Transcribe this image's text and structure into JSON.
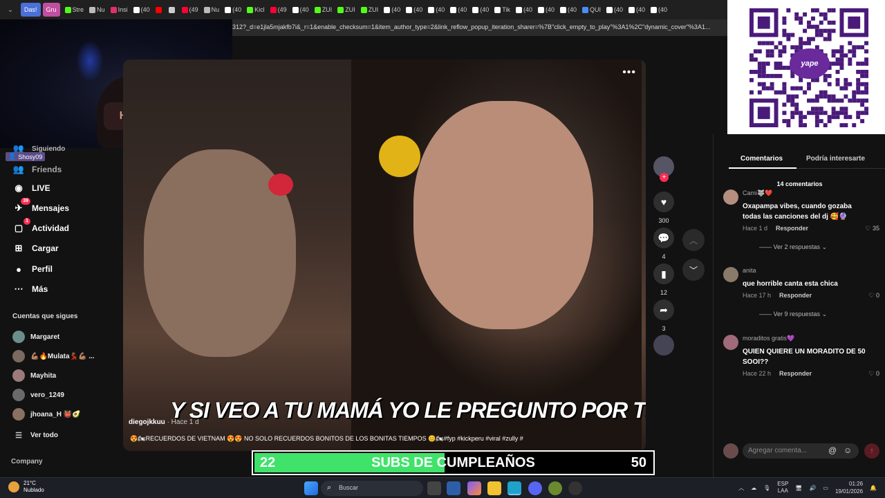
{
  "browser": {
    "tabs": [
      {
        "label": "Das!",
        "style": "pill"
      },
      {
        "label": "Gru",
        "style": "pill2"
      },
      {
        "label": "Stre",
        "icon": "kick-icon",
        "color": "#53fc18"
      },
      {
        "label": "Nu",
        "icon": "note-icon",
        "color": "#bbb"
      },
      {
        "label": "Insi",
        "icon": "instagram-icon",
        "color": "#e1306c"
      },
      {
        "label": "(40",
        "icon": "tiktok-icon",
        "color": "#fff"
      },
      {
        "label": "",
        "icon": "youtube-icon",
        "color": "#f00"
      },
      {
        "label": "",
        "icon": "audio-icon",
        "color": "#ccc"
      },
      {
        "label": "(49",
        "icon": "record-icon",
        "color": "#f03"
      },
      {
        "label": "Nu",
        "icon": "note-icon",
        "color": "#bbb"
      },
      {
        "label": "(40",
        "icon": "tiktok-icon",
        "color": "#fff"
      },
      {
        "label": "Kicl",
        "icon": "kick-icon",
        "color": "#53fc18"
      },
      {
        "label": "(49",
        "icon": "record-icon",
        "color": "#f03"
      },
      {
        "label": "(40",
        "icon": "tiktok-icon",
        "color": "#fff"
      },
      {
        "label": "ZUI",
        "icon": "kick-icon",
        "color": "#53fc18"
      },
      {
        "label": "ZUI",
        "icon": "kick-icon",
        "color": "#53fc18"
      },
      {
        "label": "ZUI",
        "icon": "kick-icon",
        "color": "#53fc18"
      },
      {
        "label": "(40",
        "icon": "tiktok-icon",
        "color": "#fff"
      },
      {
        "label": "(40",
        "icon": "tiktok-icon",
        "color": "#fff"
      },
      {
        "label": "(40",
        "icon": "tiktok-icon",
        "color": "#fff"
      },
      {
        "label": "(40",
        "icon": "tiktok-icon",
        "color": "#fff"
      },
      {
        "label": "(40",
        "icon": "tiktok-icon",
        "color": "#fff"
      },
      {
        "label": "Tik",
        "icon": "tiktok-icon",
        "color": "#fff"
      },
      {
        "label": "(40",
        "icon": "tiktok-icon",
        "color": "#fff"
      },
      {
        "label": "(40",
        "icon": "tiktok-icon",
        "color": "#fff"
      },
      {
        "label": "(40",
        "icon": "tiktok-icon",
        "color": "#fff"
      },
      {
        "label": "QUI",
        "icon": "search-icon",
        "color": "#4a8ef0"
      },
      {
        "label": "(40",
        "icon": "tiktok-icon",
        "color": "#fff"
      },
      {
        "label": "(40",
        "icon": "tiktok-icon",
        "color": "#fff"
      },
      {
        "label": "(40",
        "icon": "tiktok-icon",
        "color": "#fff"
      }
    ],
    "url": "312?_d=e1jla5mjakfb7i&_r=1&enable_checksum=1&item_author_type=2&link_reflow_popup_iteration_sharer=%7B\"click_empty_to_play\"%3A1%2C\"dynamic_cover\"%3A1..."
  },
  "webcam": {
    "cap_text": "HOY"
  },
  "stream_overlay": {
    "user": "Shosy09"
  },
  "sidebar": {
    "partial_label": "Siguiendo",
    "nav": [
      {
        "label": "Friends",
        "icon": "friends-icon",
        "badge": "",
        "dim": true
      },
      {
        "label": "LIVE",
        "icon": "live-icon",
        "badge": ""
      },
      {
        "label": "Mensajes",
        "icon": "messages-icon",
        "badge": "39"
      },
      {
        "label": "Actividad",
        "icon": "activity-icon",
        "badge": "1"
      },
      {
        "label": "Cargar",
        "icon": "upload-icon",
        "badge": ""
      },
      {
        "label": "Perfil",
        "icon": "profile-icon",
        "badge": ""
      },
      {
        "label": "Más",
        "icon": "more-icon",
        "badge": ""
      }
    ],
    "following_title": "Cuentas que sigues",
    "following": [
      {
        "name": "Margaret",
        "color": "#6b8e8a"
      },
      {
        "name": "💪🏽🔥Mulata💃🏽💪🏽 ...",
        "color": "#7a6a60"
      },
      {
        "name": "Mayhita",
        "color": "#9a7a7a"
      },
      {
        "name": "vero_1249",
        "color": "#6a6a6a"
      },
      {
        "name": "jhoana_H 👹🥑",
        "color": "#8a7060"
      }
    ],
    "see_all": "Ver todo",
    "footer": "Company"
  },
  "video": {
    "caption": "Y SI VEO A TU MAMÁ YO LE PREGUNTO POR TI😃⛱️",
    "author": "diegojkkuu",
    "time": "· Hace 1 d",
    "description": "😍🏍RECUERDOS DE VIETNAM 😍😍 NO SOLO RECUERDOS BONITOS DE LOS BONITAS TIEMPOS 😊🏍#fyp #kickperu #viral #zully #"
  },
  "actions": {
    "likes": "300",
    "comments": "4",
    "saves": "12",
    "shares": "3"
  },
  "comments_panel": {
    "tabs": [
      "Comentarios",
      "Podría interesarte"
    ],
    "count_label": "14 comentarios",
    "items": [
      {
        "user": "Cami🐺❤️",
        "text": "Oxapampa vibes, cuando gozaba todas las canciones del dj 🥰🔮",
        "time": "Hace 1 d",
        "reply": "Responder",
        "likes": "35",
        "replies": "Ver 2 respuestas",
        "avatar": "#b48e7e"
      },
      {
        "user": "anita",
        "text": "que horrible canta esta chica",
        "time": "Hace 17 h",
        "reply": "Responder",
        "likes": "0",
        "replies": "Ver 9 respuestas",
        "avatar": "#8a7a6a"
      },
      {
        "user": "moraditos gratis💜",
        "text": "QUIEN QUIERE UN MORADITO DE 50 SOOI??",
        "time": "Hace 22 h",
        "reply": "Responder",
        "likes": "0",
        "replies": "",
        "avatar": "#a06a7a"
      }
    ],
    "input_placeholder": "Agregar comenta..."
  },
  "qr": {
    "brand": "yape"
  },
  "subs_goal": {
    "current": "22",
    "label": "SUBS DE CUMPLEAÑOS",
    "goal": "50",
    "progress": 0.44,
    "color": "#3fe36a"
  },
  "taskbar": {
    "temp": "21°C",
    "weather": "Nublado",
    "search": "Buscar",
    "lang": "ESP",
    "lang2": "LAA",
    "time": "01:26",
    "date": "19/01/2026"
  }
}
